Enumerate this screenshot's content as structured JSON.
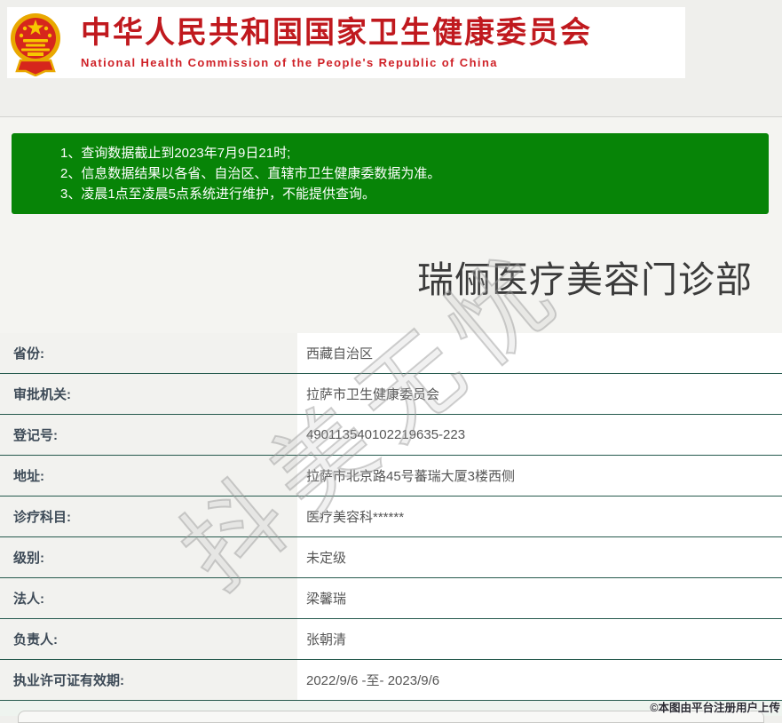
{
  "header": {
    "emblem_icon": "china-national-emblem",
    "title_cn": "中华人民共和国国家卫生健康委员会",
    "title_en": "National Health Commission of the People's Republic of China"
  },
  "notice": {
    "line1": "1、查询数据截止到2023年7月9日21时;",
    "line2": "2、信息数据结果以各省、自治区、直辖市卫生健康委数据为准。",
    "line3": "3、凌晨1点至凌晨5点系统进行维护，不能提供查询。"
  },
  "org": {
    "name": "瑞俪医疗美容门诊部"
  },
  "table": {
    "rows": [
      {
        "label": "省份:",
        "value": "西藏自治区"
      },
      {
        "label": "审批机关:",
        "value": "拉萨市卫生健康委员会"
      },
      {
        "label": "登记号:",
        "value": "490113540102219635-223"
      },
      {
        "label": "地址:",
        "value": "拉萨市北京路45号蕃瑞大厦3楼西侧"
      },
      {
        "label": "诊疗科目:",
        "value": "医疗美容科******"
      },
      {
        "label": "级别:",
        "value": "未定级"
      },
      {
        "label": "法人:",
        "value": "梁馨瑞"
      },
      {
        "label": "负责人:",
        "value": "张朝清"
      },
      {
        "label": "执业许可证有效期:",
        "value": "2022/9/6 -至- 2023/9/6"
      }
    ]
  },
  "watermark": {
    "diagonal_text": "抖美无忧",
    "footer_text": "©本图由平台注册用户上传"
  },
  "colors": {
    "notice_green": "#078407",
    "header_red": "#c0191e",
    "table_border_teal": "#265a4e"
  }
}
